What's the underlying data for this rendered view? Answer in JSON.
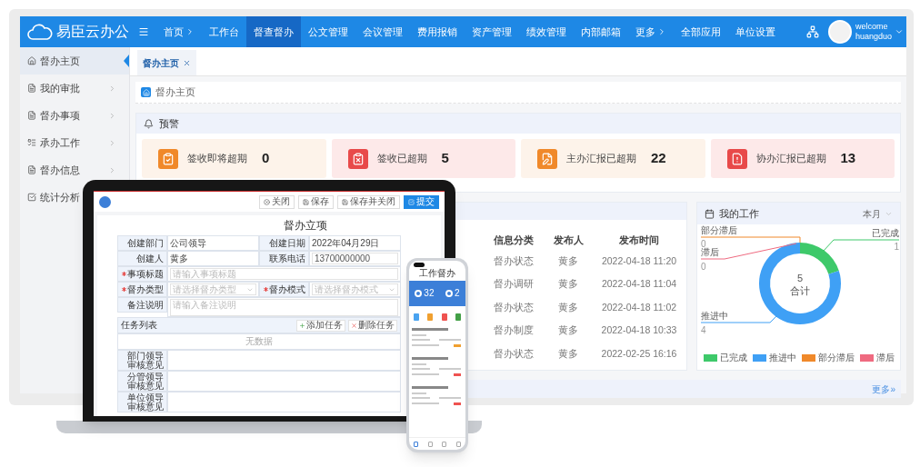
{
  "header": {
    "logo_text": "易臣云办公",
    "nav": [
      {
        "label": "首页",
        "has_arrow": true,
        "selected": false
      },
      {
        "label": "工作台",
        "has_arrow": false,
        "selected": false
      },
      {
        "label": "督查督办",
        "has_arrow": false,
        "selected": true
      },
      {
        "label": "公文管理",
        "has_arrow": false,
        "selected": false
      },
      {
        "label": "会议管理",
        "has_arrow": false,
        "selected": false
      },
      {
        "label": "费用报销",
        "has_arrow": false,
        "selected": false
      },
      {
        "label": "资产管理",
        "has_arrow": false,
        "selected": false
      },
      {
        "label": "绩效管理",
        "has_arrow": false,
        "selected": false
      },
      {
        "label": "内部邮箱",
        "has_arrow": false,
        "selected": false
      },
      {
        "label": "更多",
        "has_arrow": true,
        "selected": false
      },
      {
        "label": "全部应用",
        "has_arrow": false,
        "selected": false
      },
      {
        "label": "单位设置",
        "has_arrow": false,
        "selected": false
      }
    ],
    "user": {
      "greeting": "welcome",
      "name": "huangduo"
    }
  },
  "sidebar": {
    "items": [
      {
        "label": "督办主页",
        "selected": true,
        "has_arrow": false
      },
      {
        "label": "我的审批",
        "selected": false,
        "has_arrow": true
      },
      {
        "label": "督办事项",
        "selected": false,
        "has_arrow": true
      },
      {
        "label": "承办工作",
        "selected": false,
        "has_arrow": true
      },
      {
        "label": "督办信息",
        "selected": false,
        "has_arrow": true
      },
      {
        "label": "统计分析",
        "selected": false,
        "has_arrow": false
      }
    ]
  },
  "tabs": [
    {
      "label": "督办主页",
      "selected": true
    }
  ],
  "breadcrumb": "督办主页",
  "warning": {
    "title": "预警",
    "cards": [
      {
        "label": "签收即将超期",
        "count": "0",
        "kind": "warn"
      },
      {
        "label": "签收已超期",
        "count": "5",
        "kind": "alert"
      },
      {
        "label": "主办汇报已超期",
        "count": "22",
        "kind": "warn"
      },
      {
        "label": "协办汇报已超期",
        "count": "13",
        "kind": "alert"
      }
    ]
  },
  "news": {
    "columns": [
      "信息分类",
      "发布人",
      "发布时间"
    ],
    "rows": [
      [
        "督办状态",
        "黄多",
        "2022-04-18 11:20"
      ],
      [
        "督办调研",
        "黄多",
        "2022-04-18 11:04"
      ],
      [
        "督办状态",
        "黄多",
        "2022-04-18 11:02"
      ],
      [
        "督办制度",
        "黄多",
        "2022-04-18 10:33"
      ],
      [
        "督办状态",
        "黄多",
        "2022-02-25 16:16"
      ]
    ]
  },
  "work": {
    "title": "我的工作",
    "period": "本月",
    "center_total": "5",
    "center_label": "合计",
    "chart_data": {
      "type": "donut",
      "categories": [
        "已完成",
        "推进中",
        "部分滞后",
        "滞后"
      ],
      "values": [
        1,
        4,
        0,
        0
      ],
      "data_labels": true,
      "value_labels": [
        "1",
        "4",
        "0",
        "0"
      ]
    },
    "legend": [
      {
        "label": "已完成",
        "color": "#3ec96a"
      },
      {
        "label": "推进中",
        "color": "#3fa0f5"
      },
      {
        "label": "部分滞后",
        "color": "#f0892a"
      },
      {
        "label": "滞后",
        "color": "#ef6a80"
      }
    ]
  },
  "more_link": "更多»",
  "laptop_form": {
    "toolbar": [
      {
        "label": "关闭",
        "kind": "default"
      },
      {
        "label": "保存",
        "kind": "default"
      },
      {
        "label": "保存并关闭",
        "kind": "default"
      },
      {
        "label": "提交",
        "kind": "primary"
      }
    ],
    "title": "督办立项",
    "rows": [
      {
        "cells": [
          {
            "label": "创建部门",
            "value": "公司领导",
            "kind": "text",
            "required": false
          },
          {
            "label": "创建日期",
            "value": "2022年04月29日",
            "kind": "text",
            "required": false
          }
        ]
      },
      {
        "cells": [
          {
            "label": "创建人",
            "value": "黄多",
            "kind": "text",
            "required": false
          },
          {
            "label": "联系电话",
            "value": "13700000000",
            "kind": "input",
            "required": false
          }
        ]
      },
      {
        "cells": [
          {
            "label": "事项标题",
            "placeholder": "请输入事项标题",
            "kind": "input",
            "required": true
          }
        ]
      },
      {
        "cells": [
          {
            "label": "督办类型",
            "placeholder": "请选择督办类型",
            "kind": "select",
            "required": true
          },
          {
            "label": "督办模式",
            "placeholder": "请选择督办模式",
            "kind": "select",
            "required": true
          }
        ]
      },
      {
        "cells": [
          {
            "label": "备注说明",
            "placeholder": "请输入备注说明",
            "kind": "textarea",
            "required": false
          }
        ]
      }
    ],
    "task_list": {
      "title": "任务列表",
      "buttons": [
        "添加任务",
        "删除任务"
      ],
      "empty_text": "无数据"
    },
    "opinions": [
      "部门领导审核意见",
      "分管领导审核意见",
      "单位领导审核意见"
    ]
  },
  "phone": {
    "title": "工作督办",
    "stats": [
      "32",
      "2"
    ]
  }
}
